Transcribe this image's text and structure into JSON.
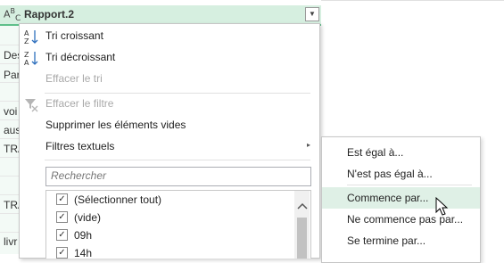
{
  "column": {
    "type_icon": "A",
    "type_sup": "B",
    "type_sub": "C",
    "title": "Rapport.2",
    "dropdown_icon": "▼"
  },
  "grid_cells": [
    "Des",
    "Par",
    "voi",
    "aus",
    "TRA",
    "TRA",
    "livr"
  ],
  "menu": {
    "sort_asc": "Tri croissant",
    "sort_desc": "Tri décroissant",
    "clear_sort": "Effacer le tri",
    "clear_filter": "Effacer le filtre",
    "remove_empty": "Supprimer les éléments vides",
    "text_filters": "Filtres textuels",
    "submenu_arrow": "▸"
  },
  "search": {
    "placeholder": "Rechercher"
  },
  "list_items": [
    {
      "label": "(Sélectionner tout)",
      "checked": true
    },
    {
      "label": "(vide)",
      "checked": true
    },
    {
      "label": "09h",
      "checked": true
    },
    {
      "label": "14h",
      "checked": true
    }
  ],
  "submenu": {
    "items": [
      "Est égal à...",
      "N'est pas égal à...",
      "Commence par...",
      "Ne commence pas par...",
      "Se termine par..."
    ]
  },
  "colors": {
    "header_bg": "#d6efe0",
    "header_border": "#5fbf8a",
    "hover_bg": "#dff0e6"
  }
}
